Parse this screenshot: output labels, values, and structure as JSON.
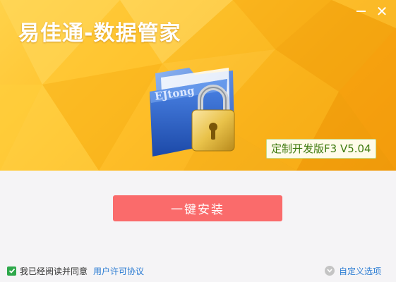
{
  "window": {
    "title": "易佳通-数据管家",
    "minimize_icon": "minimize-icon",
    "close_icon": "close-icon",
    "close_glyph": "✕"
  },
  "banner": {
    "version": "定制开发版F3 V5.04",
    "art": "folder-lock-illustration",
    "folder_lettering": "EJtong",
    "colors": {
      "gold": "#ffc12a",
      "orange": "#f09a0b",
      "folder_blue": "#2f6ad6",
      "lock_gold": "#e9c24a"
    }
  },
  "main": {
    "install_button_label": "一键安装",
    "install_button_color": "#fa6b6b"
  },
  "footer": {
    "agree_checked": true,
    "agree_text": "我已经阅读并同意",
    "license_link": "用户许可协议",
    "custom_options": "自定义选项"
  }
}
